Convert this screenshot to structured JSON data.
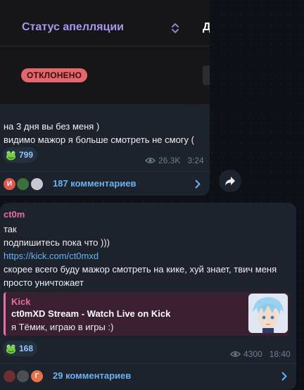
{
  "post1": {
    "media": {
      "header_title": "Статус апелляции",
      "header_col": "Д",
      "status_badge": "ОТКЛОНЕНО"
    },
    "text_line1": "на 3 дня вы без меня )",
    "text_line2": "видимо мажор я больше смотреть не смогу (",
    "reaction_count": "799",
    "views": "26.3K",
    "time": "3:24",
    "commenter_initial": "И",
    "comments_label": "187 комментариев"
  },
  "post2": {
    "sender": "ct0m",
    "line1": "так",
    "line2": "подпишитесь пока что )))",
    "link": "https://kick.com/ct0mxd",
    "line3": "скорее всего буду мажор смотреть на кике, хуй знает, твич меня просто уничтожает",
    "preview": {
      "site": "Kick",
      "title": "ct0mXD Stream - Watch Live on Kick",
      "description": "я Тёмик, играю в игры :)"
    },
    "reaction_count": "168",
    "views": "4300",
    "time": "18:40",
    "commenter_initial": "Г",
    "comments_label": "29 комментариев"
  },
  "colors": {
    "background": "#0d1117",
    "bubble": "#1c232c",
    "accent_link": "#6ab2f2",
    "sender_pink": "#e86ea3",
    "rejected_badge": "#e4686b",
    "media_title_purple": "#a996ef"
  },
  "icons": [
    "sort-icon",
    "frog-reaction-icon",
    "eye-icon",
    "chevron-right-icon",
    "share-icon",
    "avatar-icon"
  ]
}
